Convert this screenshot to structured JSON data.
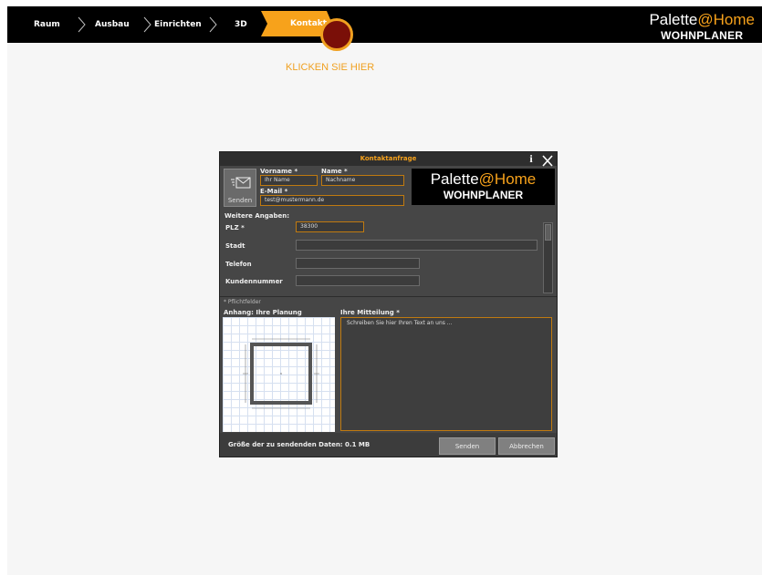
{
  "nav": {
    "items": [
      "Raum",
      "Ausbau",
      "Einrichten",
      "3D"
    ],
    "active": "Kontakt"
  },
  "brand": {
    "name_main": "Palette",
    "name_accent": "@Home",
    "subtitle": "WOHNPLANER"
  },
  "hint": "KLICKEN SIE HIER",
  "dialog": {
    "title": "Kontaktanfrage",
    "send_tile_label": "Senden",
    "vorname_label": "Vorname *",
    "vorname_value": "Ihr Name",
    "name_label": "Name *",
    "name_value": "Nachname",
    "email_label": "E-Mail *",
    "email_value": "test@mustermann.de",
    "more_label": "Weitere Angaben:",
    "plz_label": "PLZ *",
    "plz_value": "38300",
    "stadt_label": "Stadt",
    "stadt_value": "",
    "telefon_label": "Telefon",
    "telefon_value": "",
    "kunden_label": "Kundennummer",
    "kunden_value": "",
    "required_note": "* Pflichtfelder",
    "attachment_label": "Anhang: Ihre Planung",
    "message_label": "Ihre Mitteilung *",
    "message_placeholder": "Schreiben Sie hier Ihren Text an uns ...",
    "size_text": "Größe der zu sendenden Daten: 0.1 MB",
    "send_button": "Senden",
    "cancel_button": "Abbrechen"
  },
  "colors": {
    "accent": "#f7a21b",
    "dialog_bg": "#464646",
    "topbar_bg": "#000000"
  }
}
